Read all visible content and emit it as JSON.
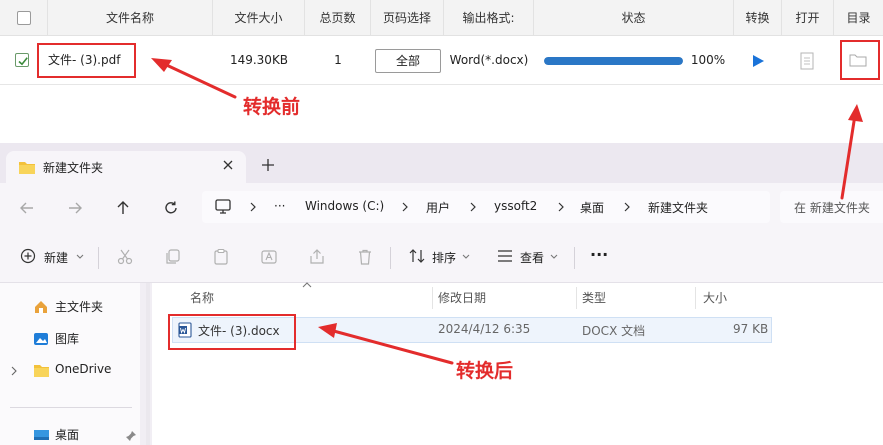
{
  "converter": {
    "headers": {
      "name": "文件名称",
      "size": "文件大小",
      "pages": "总页数",
      "page_select": "页码选择",
      "format": "输出格式:",
      "status": "状态",
      "convert": "转换",
      "open": "打开",
      "folder": "目录"
    },
    "row": {
      "checked": true,
      "name": "文件- (3).pdf",
      "size": "149.30KB",
      "pages": "1",
      "page_select": "全部",
      "format": "Word(*.docx)",
      "progress_percent": 100,
      "progress_text": "100%"
    }
  },
  "explorer": {
    "tab_title": "新建文件夹",
    "breadcrumbs": [
      "Windows (C:)",
      "用户",
      "yssoft2",
      "桌面",
      "新建文件夹"
    ],
    "more": "···",
    "search_placeholder": "在 新建文件夹",
    "toolbar": {
      "new_label": "新建",
      "sort_label": "排序",
      "view_label": "查看",
      "more_label": "···"
    },
    "sidebar": {
      "items": [
        "主文件夹",
        "图库",
        "OneDrive",
        "桌面"
      ]
    },
    "columns": {
      "name": "名称",
      "modified": "修改日期",
      "type": "类型",
      "size": "大小"
    },
    "file": {
      "name": "文件- (3).docx",
      "modified": "2024/4/12 6:35",
      "type": "DOCX 文档",
      "size": "97 KB"
    }
  },
  "annotations": {
    "before": "转换前",
    "after": "转换后"
  },
  "colors": {
    "annotation_red": "#e32c2c",
    "progress_blue": "#2a77c6",
    "play_blue": "#1a73d9",
    "check_green": "#3a8a3a",
    "folder_yellow": "#f3c13a"
  }
}
